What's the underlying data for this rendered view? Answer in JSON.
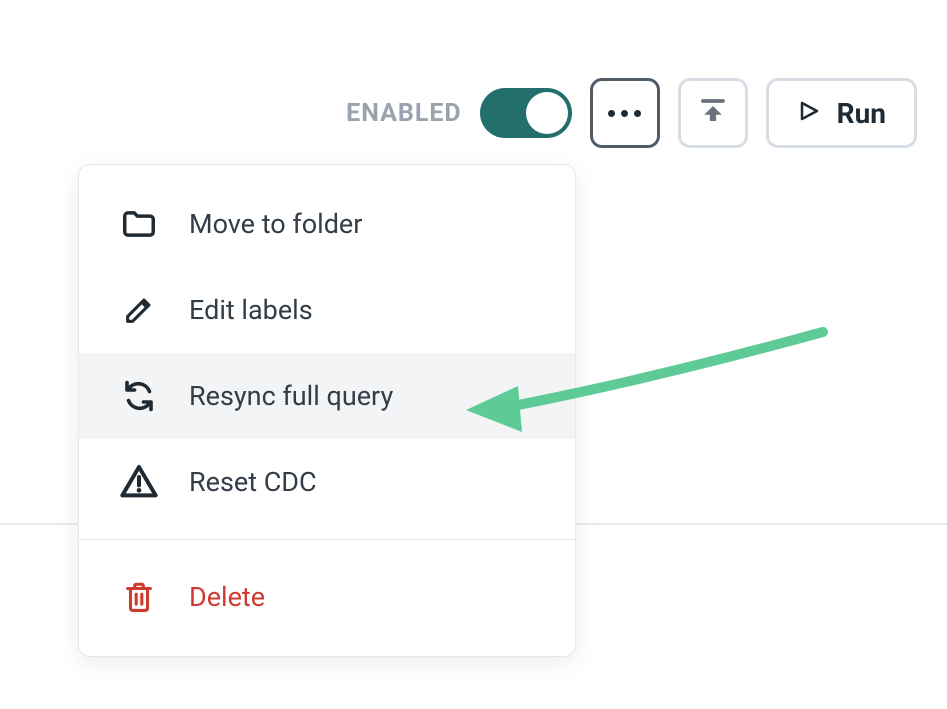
{
  "toolbar": {
    "enabled_label": "ENABLED",
    "run_label": "Run"
  },
  "menu": {
    "move_to_folder": "Move to folder",
    "edit_labels": "Edit labels",
    "resync_full_query": "Resync full query",
    "reset_cdc": "Reset CDC",
    "delete": "Delete"
  },
  "colors": {
    "toggle_on": "#226f6c",
    "danger": "#cf3b31",
    "arrow": "#5ecb96"
  }
}
